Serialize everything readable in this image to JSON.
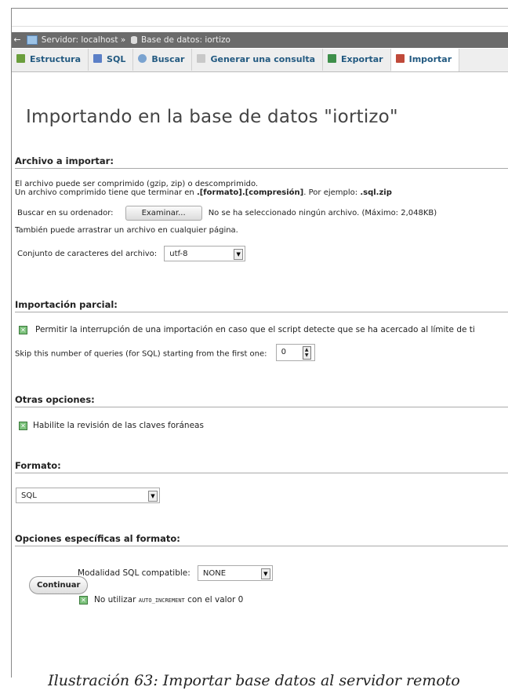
{
  "breadcrumb": {
    "server_label": "Servidor: localhost",
    "separator": "»",
    "db_label": "Base de datos: iortizo"
  },
  "tabs": [
    {
      "label": "Estructura",
      "icon": "structure-icon",
      "color": "#6a9e3c"
    },
    {
      "label": "SQL",
      "icon": "sql-icon",
      "color": "#5b7fc7"
    },
    {
      "label": "Buscar",
      "icon": "search-icon",
      "color": "#7aa3d0"
    },
    {
      "label": "Generar una consulta",
      "icon": "query-icon",
      "color": "#c8c8c8"
    },
    {
      "label": "Exportar",
      "icon": "export-icon",
      "color": "#3e8f4a"
    },
    {
      "label": "Importar",
      "icon": "import-icon",
      "color": "#c04a3a"
    }
  ],
  "page_title": "Importando en la base de datos \"iortizo\"",
  "archivo": {
    "title": "Archivo a importar:",
    "line1": "El archivo puede ser comprimido (gzip, zip) o descomprimido.",
    "line2_pre": "Un archivo comprimido tiene que terminar en ",
    "line2_bold": ".[formato].[compresión]",
    "line2_mid": ". Por ejemplo: ",
    "line2_example": ".sql.zip",
    "browse_label": "Buscar en su ordenador:",
    "browse_button": "Examinar...",
    "no_file": "No se ha seleccionado ningún archivo. (Máximo: 2,048KB)",
    "drag_hint": "También puede arrastrar un archivo en cualquier página.",
    "charset_label": "Conjunto de caracteres del archivo:",
    "charset_value": "utf-8"
  },
  "parcial": {
    "title": "Importación parcial:",
    "allow_interrupt": "Permitir la interrupción de una importación en caso que el script detecte que se ha acercado al límite de ti",
    "skip_label": "Skip this number of queries (for SQL) starting from the first one:",
    "skip_value": "0"
  },
  "otras": {
    "title": "Otras opciones:",
    "fk_check": "Habilite la revisión de las claves foráneas"
  },
  "formato": {
    "title": "Formato:",
    "value": "SQL"
  },
  "especificas": {
    "title": "Opciones específicas al formato:",
    "compat_label": "Modalidad SQL compatible:",
    "compat_value": "NONE",
    "no_autoinc_pre": "No utilizar ",
    "no_autoinc_code": "AUTO_INCREMENT",
    "no_autoinc_post": " con el valor 0"
  },
  "submit": "Continuar",
  "caption": "Ilustración 63: Importar base datos al servidor remoto"
}
